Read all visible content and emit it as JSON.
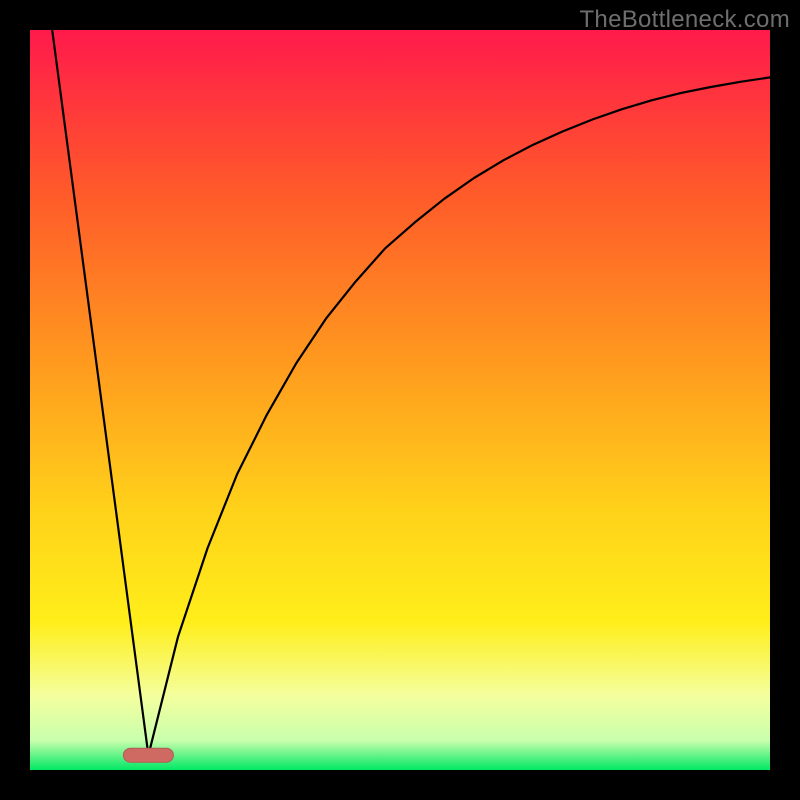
{
  "watermark": "TheBottleneck.com",
  "chart_data": {
    "type": "line",
    "title": "",
    "xlabel": "",
    "ylabel": "",
    "xlim": [
      0,
      100
    ],
    "ylim": [
      0,
      100
    ],
    "grid": false,
    "legend": null,
    "colors": {
      "gradient_top": "#ff1a4b",
      "gradient_mid_high": "#ff8a1e",
      "gradient_mid": "#ffe21a",
      "gradient_low": "#f4ff9e",
      "gradient_bottom": "#00e864",
      "curve": "#000000",
      "marker_fill": "#cf6a63",
      "marker_stroke": "#b45a55",
      "frame": "#000000"
    },
    "marker": {
      "x": 16,
      "y": 2
    },
    "series": [
      {
        "name": "left-descent",
        "x": [
          3,
          16
        ],
        "y": [
          100,
          2
        ]
      },
      {
        "name": "right-curve",
        "x": [
          16,
          20,
          24,
          28,
          32,
          36,
          40,
          44,
          48,
          52,
          56,
          60,
          64,
          68,
          72,
          76,
          80,
          84,
          88,
          92,
          96,
          100
        ],
        "y": [
          2,
          18,
          30,
          40,
          48,
          55,
          61,
          66,
          70.5,
          74,
          77.2,
          80,
          82.4,
          84.5,
          86.3,
          87.9,
          89.3,
          90.5,
          91.5,
          92.3,
          93,
          93.6
        ]
      }
    ]
  }
}
